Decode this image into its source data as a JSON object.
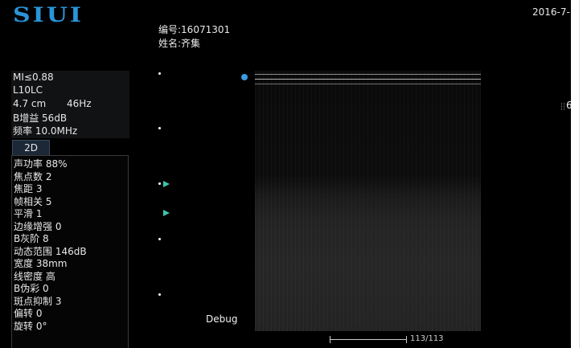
{
  "brand": {
    "logo_text": "SIUI",
    "color": "#2a94d8"
  },
  "header": {
    "date": "2016-7-"
  },
  "patient": {
    "id_line": "编号:16071301",
    "name_line": "姓名:齐集"
  },
  "probe_info": {
    "mi": "MI≤0.88",
    "probe": "L10LC",
    "depth": "4.7 cm",
    "frame_rate": "46Hz",
    "b_gain": "B增益 56dB",
    "frequency": "频率 10.0MHz"
  },
  "mode": {
    "active_tab": "2D"
  },
  "params": [
    "声功率 88%",
    "焦点数 2",
    "焦距 3",
    "帧相关 5",
    "平滑 1",
    "边缘增强 0",
    "B灰阶 8",
    "动态范围 146dB",
    "宽度 38mm",
    "线密度 高",
    "B伪彩 0",
    "斑点抑制 3",
    "偏转 0",
    "旋转 0°"
  ],
  "debug": {
    "label": "Debug"
  },
  "cine": {
    "frame_counter": "113/113",
    "progress": 1.0
  },
  "edge": {
    "glyph": "6"
  },
  "colors": {
    "background": "#000000",
    "focus_marker": "#3ec3b0",
    "orientation_marker": "#3a9be6",
    "panel": "#111214"
  }
}
